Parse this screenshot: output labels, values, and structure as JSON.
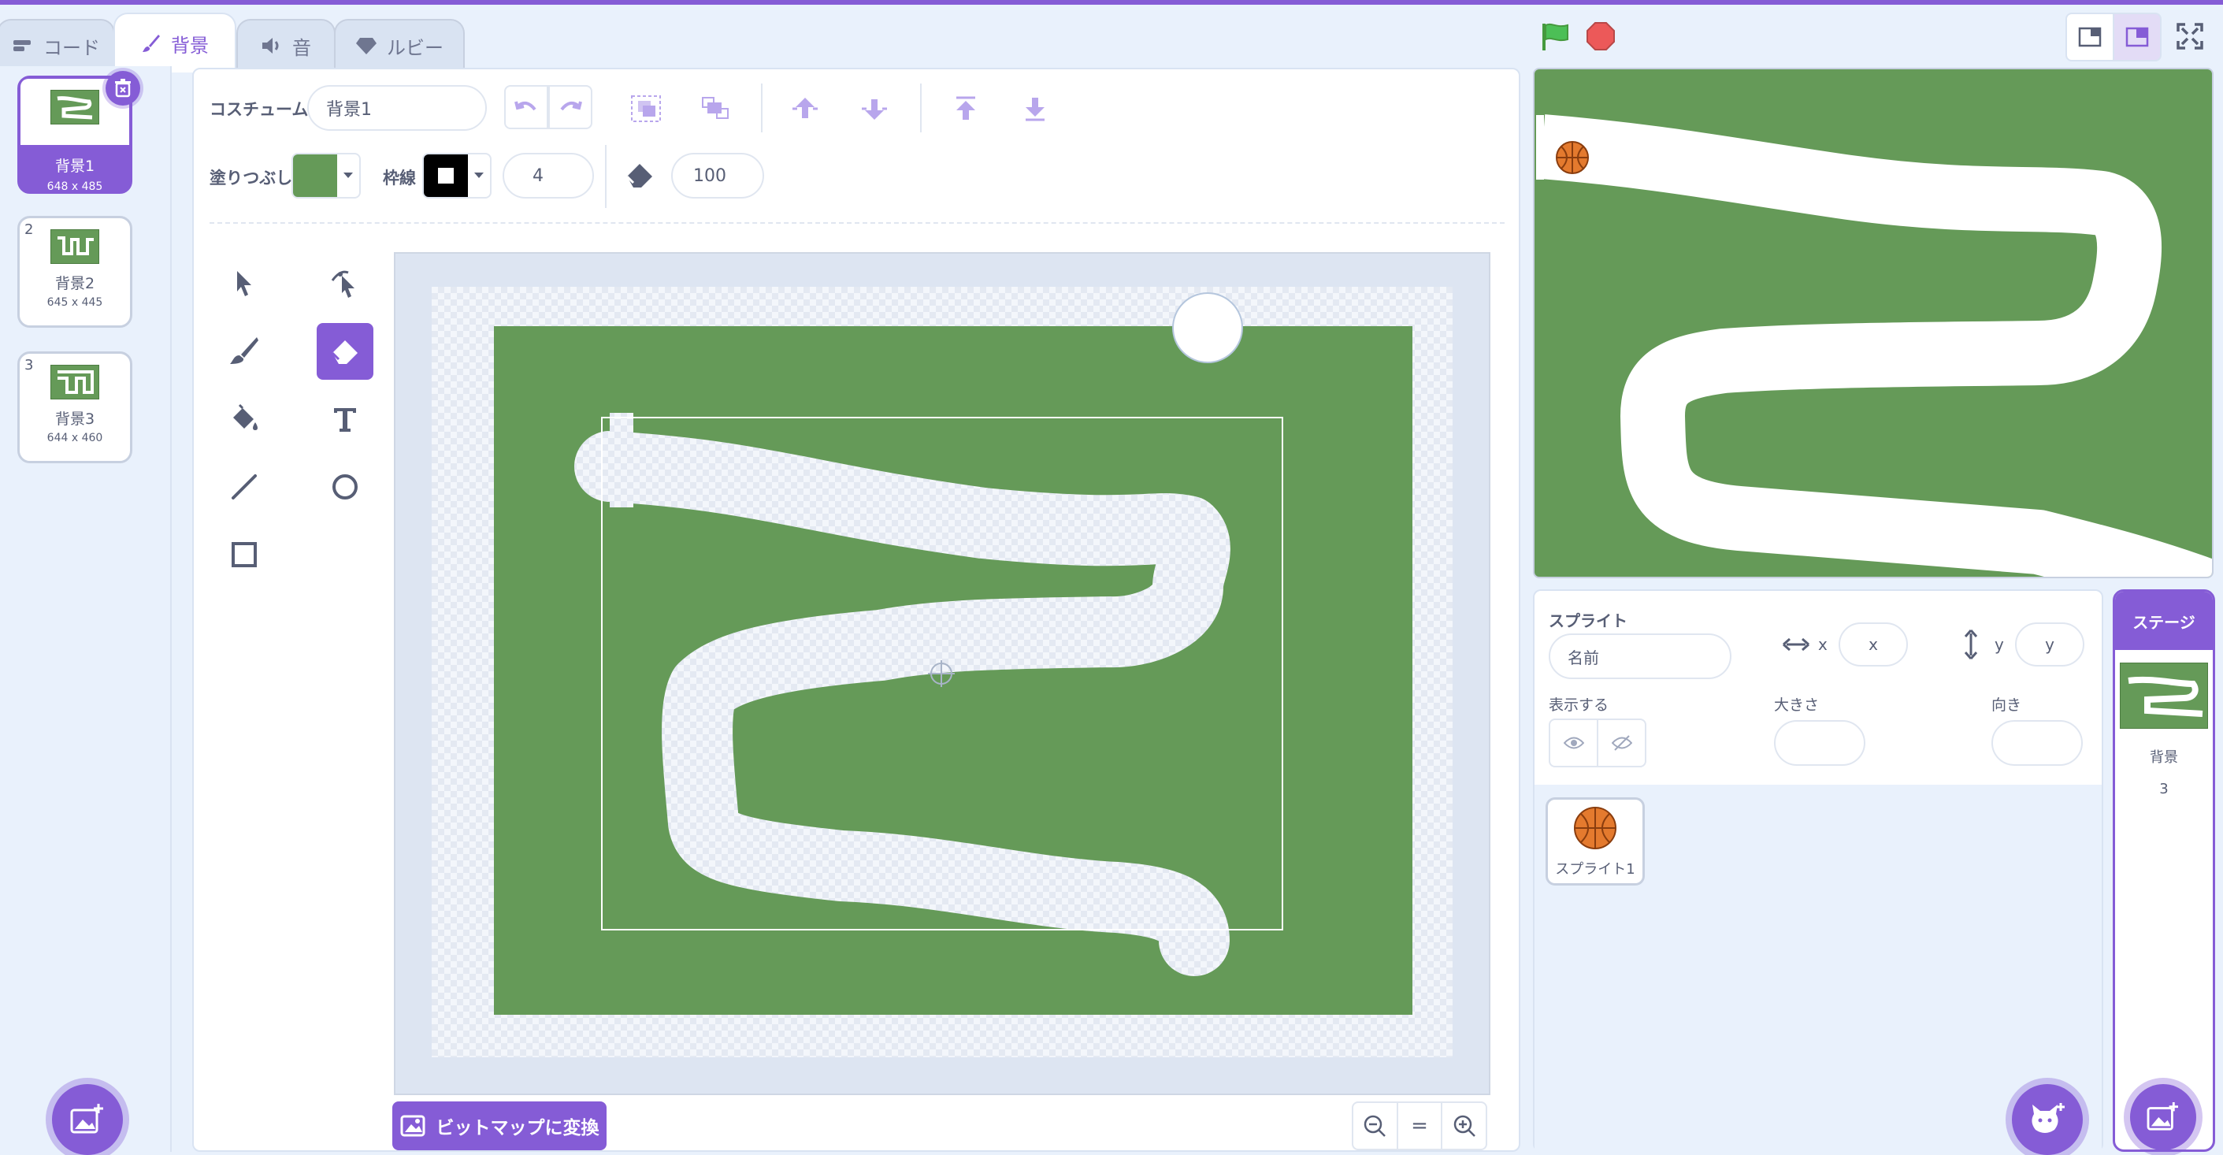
{
  "tabs": [
    {
      "label": "コード"
    },
    {
      "label": "背景"
    },
    {
      "label": "音"
    },
    {
      "label": "ルビー"
    }
  ],
  "costumes": [
    {
      "num": "1",
      "name": "背景1",
      "size": "648 x 485"
    },
    {
      "num": "2",
      "name": "背景2",
      "size": "645 x 445"
    },
    {
      "num": "3",
      "name": "背景3",
      "size": "644 x 460"
    }
  ],
  "editor": {
    "costume_label": "コスチューム",
    "costume_name": "背景1",
    "fill_label": "塗りつぶし",
    "outline_label": "枠線",
    "outline_width": "4",
    "eraser_size": "100",
    "convert_button": "ビットマップに変換",
    "zoom_reset": "="
  },
  "colors": {
    "accent": "#855cd6",
    "fill_color": "#659a58",
    "outline_color": "#000000",
    "backdrop_green": "#659a58"
  },
  "sprite_info": {
    "title": "スプライト",
    "name_placeholder": "名前",
    "x_label": "x",
    "x_placeholder": "x",
    "y_label": "y",
    "y_placeholder": "y",
    "show_label": "表示する",
    "size_label": "大きさ",
    "direction_label": "向き"
  },
  "sprites": [
    {
      "name": "スプライト1"
    }
  ],
  "stage_panel": {
    "title": "ステージ",
    "backdrop_label": "背景",
    "backdrop_count": "3"
  }
}
